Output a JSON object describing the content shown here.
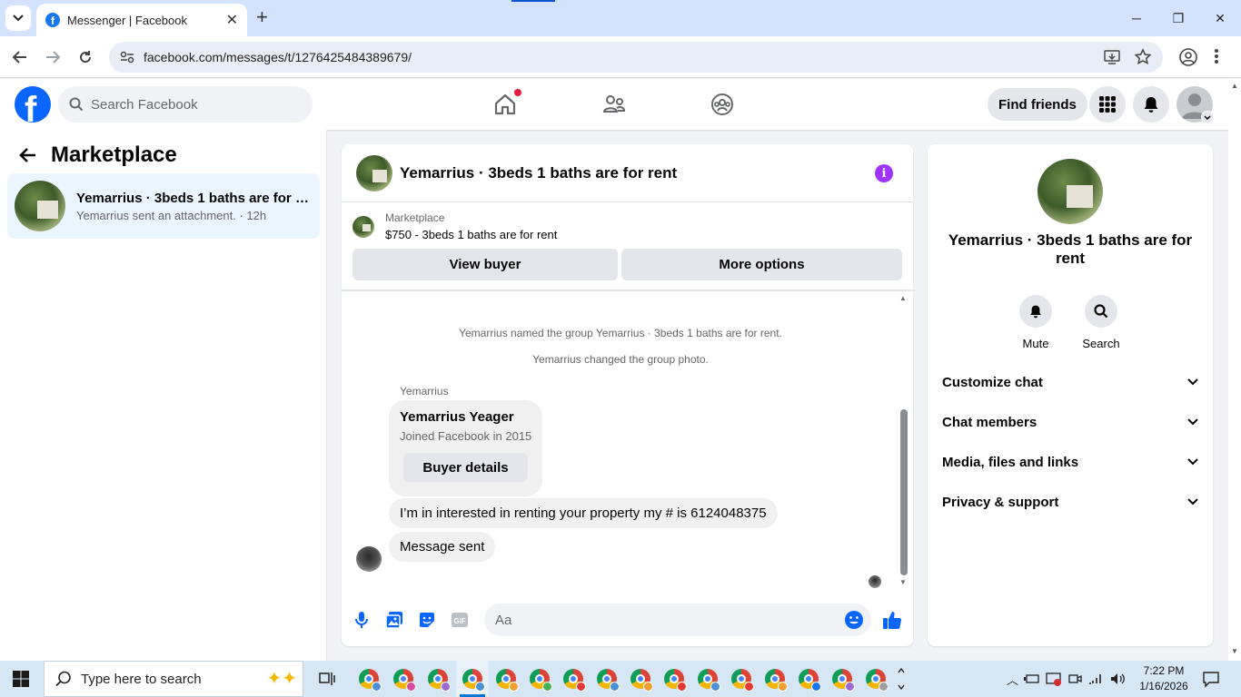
{
  "browser": {
    "tab_title": "Messenger | Facebook",
    "url": "facebook.com/messages/t/1276425484389679/"
  },
  "fb": {
    "search_placeholder": "Search Facebook",
    "find_friends": "Find friends",
    "brand_color": "#0866ff",
    "home_has_notification": true
  },
  "left": {
    "heading": "Marketplace",
    "conversation": {
      "title": "Yemarrius · 3beds 1 baths are for r...",
      "subtitle": "Yemarrius sent an attachment. · 12h"
    }
  },
  "chat": {
    "title": "Yemarrius · 3beds 1 baths are for rent",
    "listing_label": "Marketplace",
    "listing_price": "$750 - 3beds 1 baths are for rent",
    "view_buyer": "View buyer",
    "more_options": "More options",
    "system_messages": [
      "Yemarrius named the group Yemarrius · 3beds 1 baths are for rent.",
      "Yemarrius changed the group photo."
    ],
    "sender_name": "Yemarrius",
    "card": {
      "name": "Yemarrius Yeager",
      "joined": "Joined Facebook in 2015",
      "button": "Buyer details"
    },
    "messages": [
      "I’m in interested in renting your property my # is 6124048375",
      "Message sent"
    ],
    "composer_placeholder": "Aa",
    "accent_color": "#0866ff",
    "info_color": "#a033ff"
  },
  "right": {
    "name": "Yemarrius · 3beds 1 baths are for rent",
    "actions": [
      "Mute",
      "Search"
    ],
    "sections": [
      "Customize chat",
      "Chat members",
      "Media, files and links",
      "Privacy & support"
    ]
  },
  "taskbar": {
    "search_placeholder": "Type here to search",
    "time": "7:22 PM",
    "date": "1/16/2026"
  }
}
